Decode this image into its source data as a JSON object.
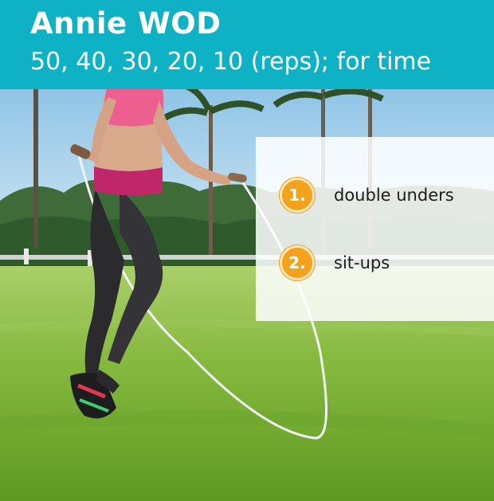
{
  "header": {
    "title": "Annie WOD",
    "subtitle": "50, 40, 30, 20, 10 (reps); for time"
  },
  "exercises": [
    {
      "number": "1.",
      "name": "double unders"
    },
    {
      "number": "2.",
      "name": "sit-ups"
    }
  ],
  "colors": {
    "header_bg": "#0fb2c4",
    "badge": "#f3a21b",
    "grass": "#7fb53c",
    "top_accent": "#ec5f8f"
  }
}
